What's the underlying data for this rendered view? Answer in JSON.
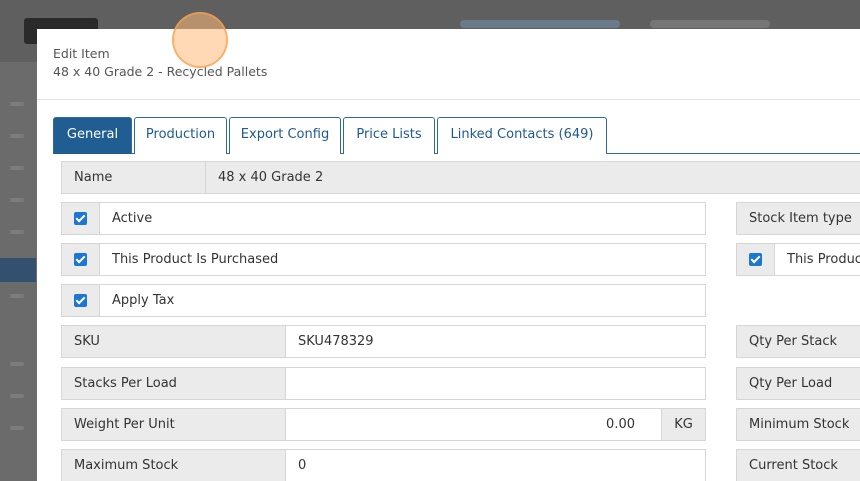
{
  "modal": {
    "header_label": "Edit Item",
    "item_title": "48 x 40 Grade 2 - Recycled Pallets"
  },
  "tabs": [
    {
      "label": "General",
      "active": true
    },
    {
      "label": "Production",
      "active": false
    },
    {
      "label": "Export Config",
      "active": false
    },
    {
      "label": "Price Lists",
      "active": false
    },
    {
      "label": "Linked Contacts (649)",
      "active": false
    }
  ],
  "form": {
    "name": {
      "label": "Name",
      "value": "48 x 40 Grade 2"
    },
    "active": {
      "label": "Active",
      "checked": true
    },
    "purchased": {
      "label": "This Product Is Purchased",
      "checked": true
    },
    "apply_tax": {
      "label": "Apply Tax",
      "checked": true
    },
    "sku": {
      "label": "SKU",
      "value": "SKU478329"
    },
    "stacks_per_load": {
      "label": "Stacks Per Load",
      "value": ""
    },
    "weight_per_unit": {
      "label": "Weight Per Unit",
      "value": "0.00",
      "unit": "KG"
    },
    "maximum_stock": {
      "label": "Maximum Stock",
      "value": "0"
    }
  },
  "right_column": {
    "stock_item_type": {
      "label": "Stock Item type"
    },
    "this_product": {
      "label": "This Product",
      "checked": true
    },
    "qty_per_stack": {
      "label": "Qty Per Stack"
    },
    "qty_per_load": {
      "label": "Qty Per Load"
    },
    "minimum_stock": {
      "label": "Minimum Stock"
    },
    "current_stock": {
      "label": "Current Stock"
    }
  },
  "colors": {
    "accent": "#1f5d93",
    "checkbox": "#1c76d2",
    "label_bg": "#ebebeb"
  }
}
